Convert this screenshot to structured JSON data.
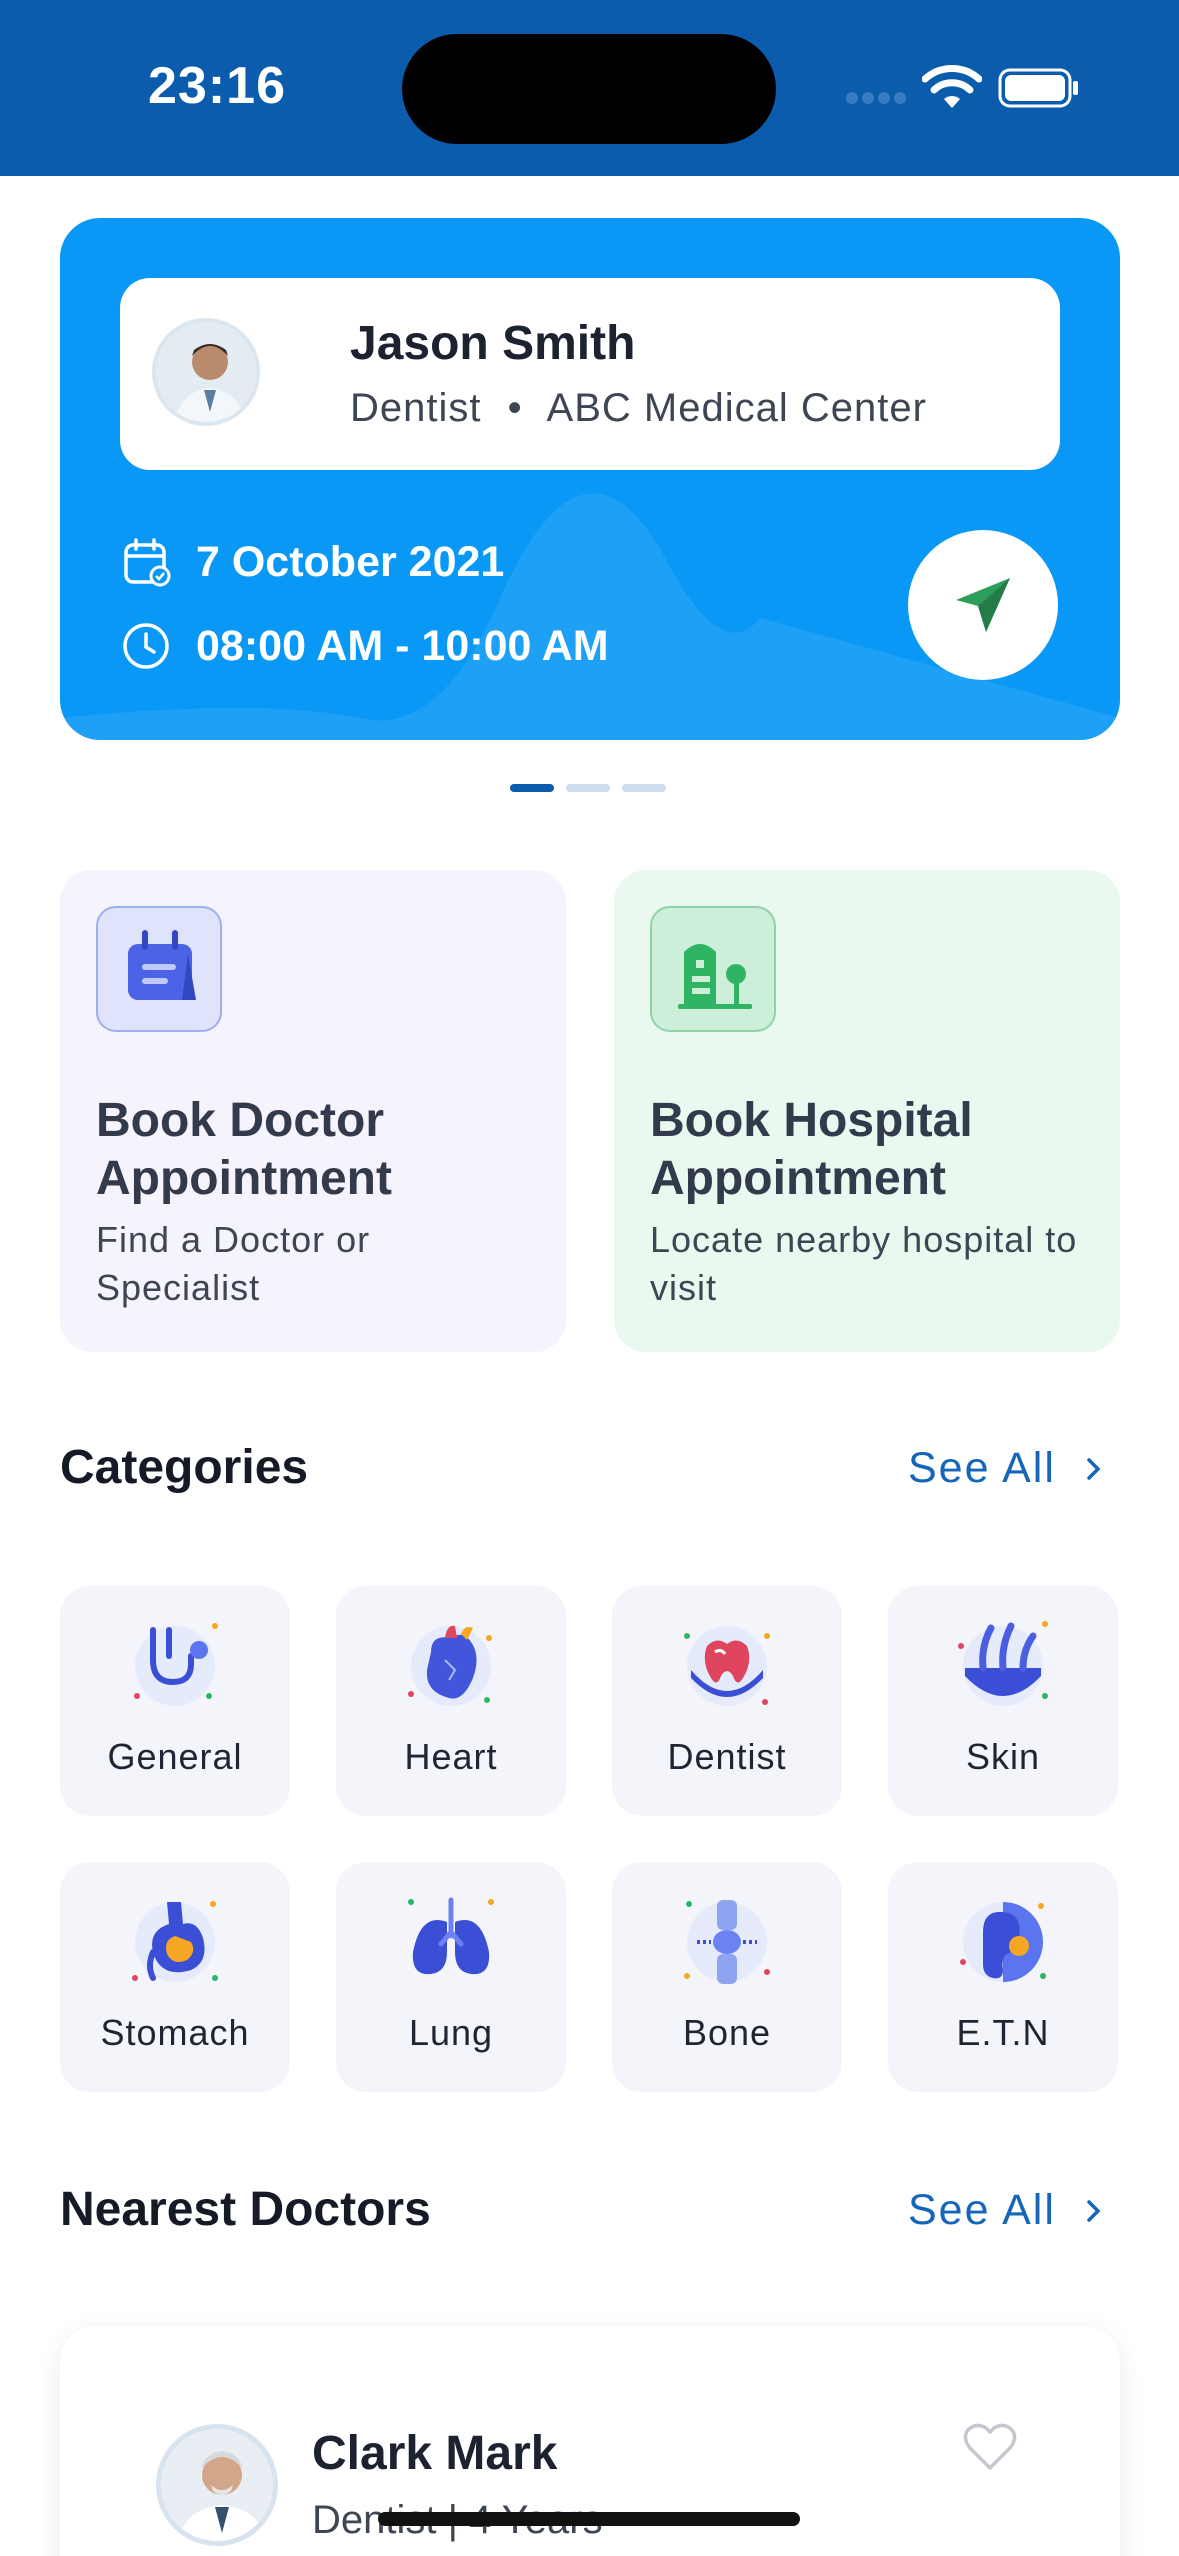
{
  "status": {
    "time": "23:16"
  },
  "appointment": {
    "doctor_name": "Jason Smith",
    "doctor_specialty": "Dentist",
    "separator": "•",
    "clinic": "ABC Medical Center",
    "date": "7 October 2021",
    "time": "08:00 AM - 10:00 AM",
    "pager": {
      "count": 3,
      "active": 0
    }
  },
  "booking": [
    {
      "title": "Book Doctor Appointment",
      "desc": "Find a Doctor or Specialist",
      "icon": "calendar-icon",
      "bg": "#f5f3fc"
    },
    {
      "title": "Book Hospital Appointment",
      "desc": "Locate nearby hospital to visit",
      "icon": "hospital-icon",
      "bg": "#eaf9ef"
    }
  ],
  "categories": {
    "title": "Categories",
    "see_all": "See All",
    "items": [
      {
        "label": "General",
        "icon": "stethoscope-icon"
      },
      {
        "label": "Heart",
        "icon": "heart-organ-icon"
      },
      {
        "label": "Dentist",
        "icon": "tooth-icon"
      },
      {
        "label": "Skin",
        "icon": "skin-icon"
      },
      {
        "label": "Stomach",
        "icon": "stomach-icon"
      },
      {
        "label": "Lung",
        "icon": "lung-icon"
      },
      {
        "label": "Bone",
        "icon": "bone-icon"
      },
      {
        "label": "E.T.N",
        "icon": "ear-icon"
      }
    ]
  },
  "nearest": {
    "title": "Nearest Doctors",
    "see_all": "See All",
    "doctors": [
      {
        "name": "Clark Mark",
        "sub": "Dentist | 4 Years"
      }
    ]
  },
  "colors": {
    "brand_blue": "#0b5cad",
    "card_blue": "#0a98f6",
    "link": "#1565b9",
    "green": "#2e9e5b"
  }
}
